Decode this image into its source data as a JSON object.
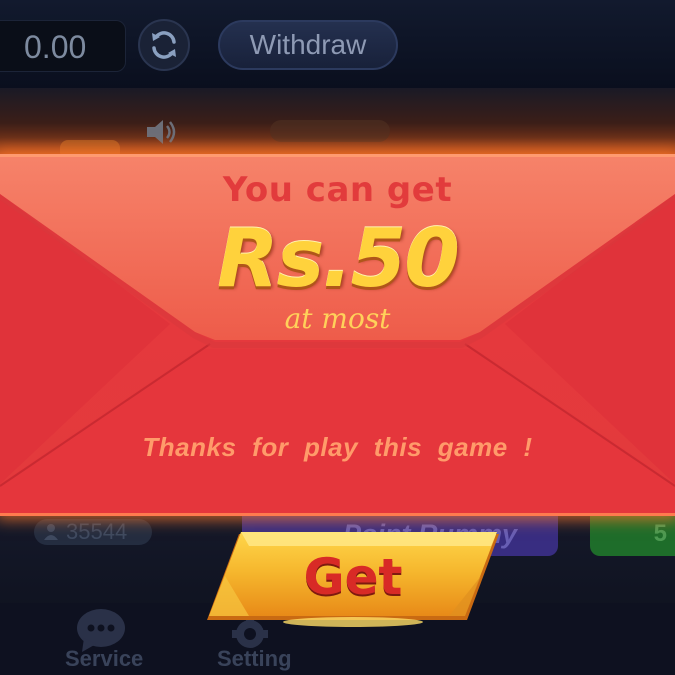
{
  "topbar": {
    "balance": "0.00",
    "refresh_icon": "refresh-icon",
    "withdraw_label": "Withdraw"
  },
  "lobby": {
    "online_players": "35544",
    "game_tile_label": "Point Rummy",
    "side_tile_label": "5"
  },
  "bottom_nav": {
    "items": [
      {
        "label": "Service",
        "icon": "chat-bubble-icon"
      },
      {
        "label": "Setting",
        "icon": "gear-icon"
      }
    ]
  },
  "bonus_modal": {
    "title": "You can get",
    "amount": "Rs.50",
    "subtitle": "at most",
    "message": "Thanks  for  play  this  game !",
    "get_button_label": "Get",
    "colors": {
      "envelope": "#e63a3e",
      "flap": "#f0735a",
      "amount": "#ffd23c",
      "button": "#f2b230"
    }
  }
}
